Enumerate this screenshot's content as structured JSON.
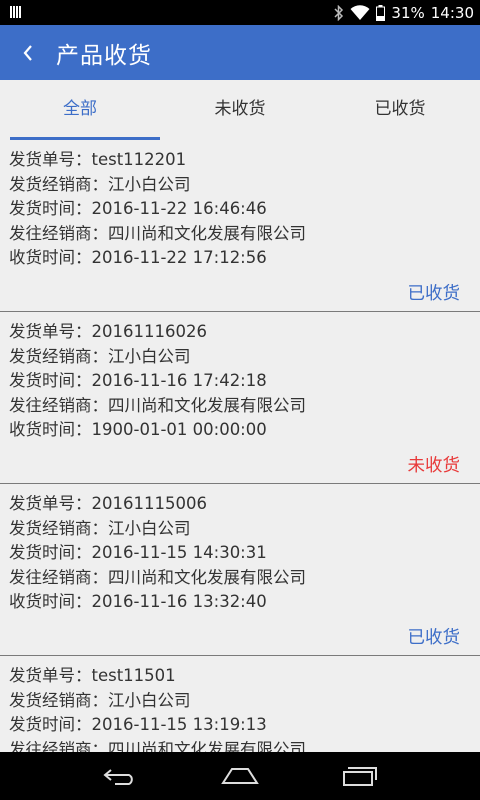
{
  "status_bar": {
    "battery": "31%",
    "time": "14:30"
  },
  "header": {
    "title": "产品收货"
  },
  "tabs": [
    {
      "label": "全部"
    },
    {
      "label": "未收货"
    },
    {
      "label": "已收货"
    }
  ],
  "orders": [
    {
      "order_no": "发货单号：test112201",
      "distributor": "发货经销商：江小白公司",
      "ship_time": "发货时间：2016-11-22 16:46:46",
      "dest": "发往经销商：四川尚和文化发展有限公司",
      "receive_time": "收货时间：2016-11-22 17:12:56",
      "status": "已收货"
    },
    {
      "order_no": "发货单号：20161116026",
      "distributor": "发货经销商：江小白公司",
      "ship_time": "发货时间：2016-11-16 17:42:18",
      "dest": "发往经销商：四川尚和文化发展有限公司",
      "receive_time": "收货时间：1900-01-01 00:00:00",
      "status": "未收货"
    },
    {
      "order_no": "发货单号：20161115006",
      "distributor": "发货经销商：江小白公司",
      "ship_time": "发货时间：2016-11-15 14:30:31",
      "dest": "发往经销商：四川尚和文化发展有限公司",
      "receive_time": "收货时间：2016-11-16 13:32:40",
      "status": "已收货"
    },
    {
      "order_no": "发货单号：test11501",
      "distributor": "发货经销商：江小白公司",
      "ship_time": "发货时间：2016-11-15 13:19:13",
      "dest": "发往经销商：四川尚和文化发展有限公司"
    }
  ],
  "colors": {
    "accent": "#3d6ec8",
    "received": "#3d6ec8",
    "not_received": "#e83a3a"
  }
}
